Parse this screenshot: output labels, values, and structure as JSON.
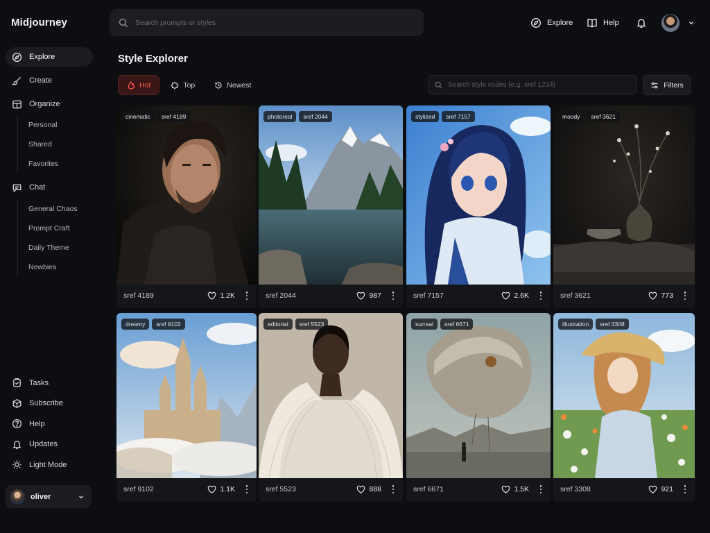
{
  "app": {
    "name": "Midjourney"
  },
  "search": {
    "placeholder": "Search prompts or styles"
  },
  "top_nav": {
    "explore": "Explore",
    "help": "Help"
  },
  "sidebar": {
    "items": {
      "explore": "Explore",
      "create": "Create",
      "organize": "Organize",
      "chat": "Chat"
    },
    "organize_children": [
      "Personal",
      "Shared",
      "Favorites"
    ],
    "chat_children": [
      "General Chaos",
      "Prompt Craft",
      "Daily Theme",
      "Newbies"
    ],
    "bottom": {
      "tasks": "Tasks",
      "subscribe": "Subscribe",
      "help": "Help",
      "updates": "Updates",
      "light_mode": "Light Mode"
    },
    "user": {
      "name": "oliver"
    }
  },
  "page": {
    "title": "Style Explorer",
    "tabs": {
      "hot": "Hot",
      "top": "Top",
      "newest": "Newest"
    },
    "style_search_placeholder": "Search style codes (e.g. sref 1234)",
    "filters_label": "Filters"
  },
  "accent_color": "#ff5a4e",
  "cards": [
    {
      "tags": [
        "cinematic",
        "sref 4189"
      ],
      "sref": "sref 4189",
      "likes": "1.2K"
    },
    {
      "tags": [
        "photoreal",
        "sref 2044"
      ],
      "sref": "sref 2044",
      "likes": "987"
    },
    {
      "tags": [
        "stylized",
        "sref 7157"
      ],
      "sref": "sref 7157",
      "likes": "2.6K"
    },
    {
      "tags": [
        "moody",
        "sref 3621"
      ],
      "sref": "sref 3621",
      "likes": "773"
    },
    {
      "tags": [
        "dreamy",
        "sref 9102"
      ],
      "sref": "sref 9102",
      "likes": "1.1K"
    },
    {
      "tags": [
        "editorial",
        "sref 5523"
      ],
      "sref": "sref 5523",
      "likes": "888"
    },
    {
      "tags": [
        "surreal",
        "sref 6671"
      ],
      "sref": "sref 6671",
      "likes": "1.5K"
    },
    {
      "tags": [
        "illustration",
        "sref 3308"
      ],
      "sref": "sref 3308",
      "likes": "921"
    }
  ]
}
